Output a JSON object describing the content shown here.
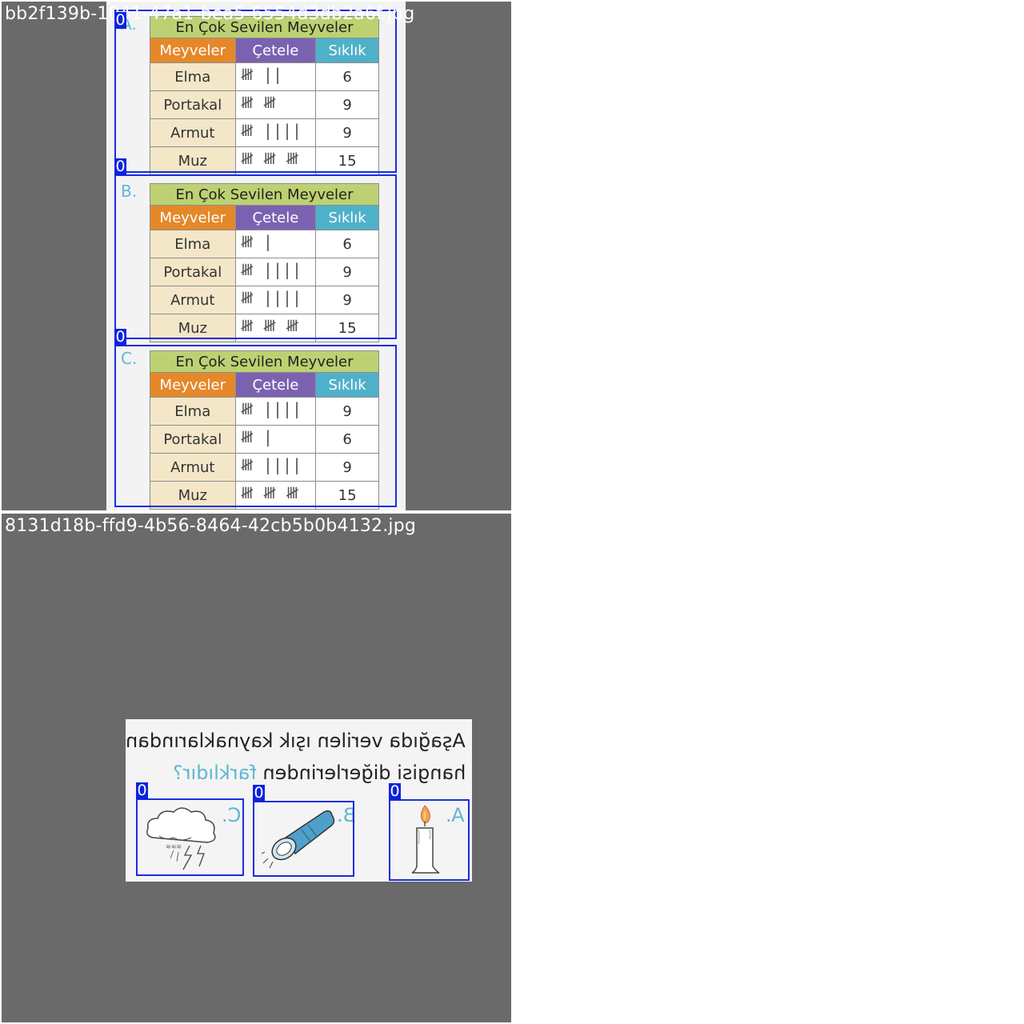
{
  "panels": [
    {
      "filename": "bb2f139b-1041-47a1-bea5-6554d3db2a6f.jpg",
      "table_title": "En Çok Sevilen Meyveler",
      "headers": [
        "Meyveler",
        "Çetele",
        "Sıklık"
      ],
      "blocks": [
        {
          "letter": "A.",
          "rows": [
            {
              "fruit": "Elma",
              "tally": "𝍸 ||",
              "freq": "6"
            },
            {
              "fruit": "Portakal",
              "tally": "𝍸 𝍸",
              "freq": "9"
            },
            {
              "fruit": "Armut",
              "tally": "𝍸 ||||",
              "freq": "9"
            },
            {
              "fruit": "Muz",
              "tally": "𝍸 𝍸 𝍸",
              "freq": "15"
            }
          ]
        },
        {
          "letter": "B.",
          "rows": [
            {
              "fruit": "Elma",
              "tally": "𝍸 |",
              "freq": "6"
            },
            {
              "fruit": "Portakal",
              "tally": "𝍸 ||||",
              "freq": "9"
            },
            {
              "fruit": "Armut",
              "tally": "𝍸 ||||",
              "freq": "9"
            },
            {
              "fruit": "Muz",
              "tally": "𝍸 𝍸 𝍸",
              "freq": "15"
            }
          ]
        },
        {
          "letter": "C.",
          "rows": [
            {
              "fruit": "Elma",
              "tally": "𝍸 ||||",
              "freq": "9"
            },
            {
              "fruit": "Portakal",
              "tally": "𝍸 |",
              "freq": "6"
            },
            {
              "fruit": "Armut",
              "tally": "𝍸 ||||",
              "freq": "9"
            },
            {
              "fruit": "Muz",
              "tally": "𝍸 𝍸 𝍸",
              "freq": "15"
            }
          ]
        }
      ],
      "detection_label": "0"
    },
    {
      "filename": "8131d18b-ffd9-4b56-8464-42cb5b0b4132.jpg",
      "question_line1": "Aşağıda verilen ışık kaynaklarından",
      "question_line2_a": "hangisi diğerlerinden ",
      "question_line2_b": "farklıdır?",
      "options": [
        "A.",
        "B.",
        "C."
      ],
      "detection_label": "0"
    }
  ],
  "colors": {
    "panel_bg": "#6a6a6a",
    "box": "#1a2de0",
    "title_bg": "#bdd172",
    "h_fruit": "#e5882a",
    "h_tally": "#7b62b1",
    "h_freq": "#4fb1c9"
  }
}
